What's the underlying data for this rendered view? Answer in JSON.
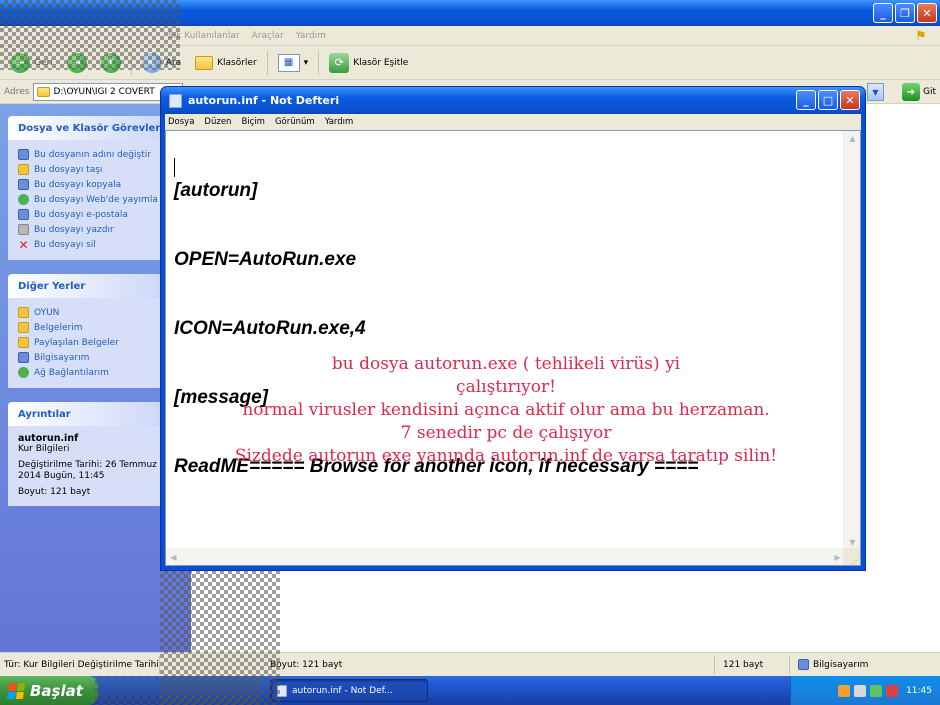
{
  "explorer": {
    "menu": [
      "Sık Kullanılanlar",
      "Araçlar",
      "Yardım"
    ],
    "toolbar": {
      "back_label": "Geri",
      "search_label": "Ara",
      "folders_label": "Klasörler",
      "sync_label": "Klasör Eşitle"
    },
    "address": {
      "label": "Adres",
      "path": "D:\\OYUN\\IGI 2 COVERT",
      "go_label": "Git"
    },
    "tasks_panel": {
      "title": "Dosya ve Klasör Görevleri",
      "items": [
        "Bu dosyanın adını değiştir",
        "Bu dosyayı taşı",
        "Bu dosyayı kopyala",
        "Bu dosyayı Web'de yayımla",
        "Bu dosyayı e-postala",
        "Bu dosyayı yazdır",
        "Bu dosyayı sil"
      ]
    },
    "places_panel": {
      "title": "Diğer Yerler",
      "items": [
        "OYUN",
        "Belgelerim",
        "Paylaşılan Belgeler",
        "Bilgisayarım",
        "Ağ Bağlantılarım"
      ]
    },
    "details_panel": {
      "title": "Ayrıntılar",
      "file_name": "autorun.inf",
      "file_type": "Kur Bilgileri",
      "modified": "Değiştirilme Tarihi: 26 Temmuz 2014 Bugün, 11:45",
      "size": "Boyut: 121 bayt"
    },
    "status": {
      "type_info": "Tür: Kur Bilgileri Değiştirilme Tarihi",
      "size_info": "Boyut: 121 bayt",
      "size": "121 bayt",
      "location": "Bilgisayarım"
    }
  },
  "notepad": {
    "title": "autorun.inf - Not Defteri",
    "menu": [
      "Dosya",
      "Düzen",
      "Biçim",
      "Görünüm",
      "Yardım"
    ],
    "lines": [
      "[autorun]",
      "OPEN=AutoRun.exe",
      "ICON=AutoRun.exe,4",
      "[message]",
      "ReadME===== Browse for another icon, if necessary ===="
    ],
    "note_lines": [
      "bu dosya autorun.exe ( tehlikeli virüs) yi",
      "çalıştırıyor!",
      "normal virusler  kendisini açınca aktif olur ama bu herzaman.",
      "7 senedir pc de çalışıyor",
      "Sizdede autorun exe yanında autorun.inf de varsa taratıp silin!"
    ]
  },
  "taskbar": {
    "start_label": "Başlat",
    "task_label": "autorun.inf - Not Def...",
    "clock": "11:45"
  },
  "colors": {
    "xp_blue": "#0a5ae0",
    "note_red": "#e0284a",
    "panel_link": "#215dc6"
  }
}
